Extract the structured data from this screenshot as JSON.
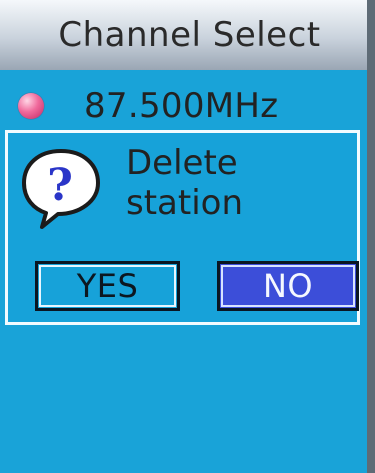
{
  "header": {
    "title": "Channel Select"
  },
  "channel": {
    "frequency": "87.500MHz",
    "indicator_color": "#e8538b"
  },
  "dialog": {
    "icon": "question-bubble-icon",
    "message_line1": "Delete",
    "message_line2": "station",
    "yes_label": "YES",
    "no_label": "NO",
    "selected_button": "NO"
  },
  "colors": {
    "background": "#19a3d8",
    "selected_button": "#3c4ed9",
    "title_bar": "#c9d2dc"
  }
}
